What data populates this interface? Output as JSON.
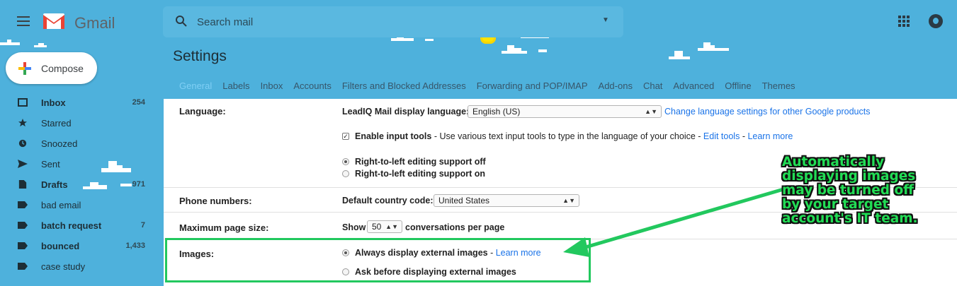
{
  "header": {
    "app_name": "Gmail",
    "search_placeholder": "Search mail"
  },
  "sidebar": {
    "compose_label": "Compose",
    "items": [
      {
        "label": "Inbox",
        "count": "254",
        "bold": true,
        "icon": "inbox-icon"
      },
      {
        "label": "Starred",
        "count": "",
        "bold": false,
        "icon": "star-icon"
      },
      {
        "label": "Snoozed",
        "count": "",
        "bold": false,
        "icon": "clock-icon"
      },
      {
        "label": "Sent",
        "count": "",
        "bold": false,
        "icon": "send-icon"
      },
      {
        "label": "Drafts",
        "count": "971",
        "bold": true,
        "icon": "draft-icon"
      },
      {
        "label": "bad email",
        "count": "",
        "bold": false,
        "icon": "label-icon"
      },
      {
        "label": "batch request",
        "count": "7",
        "bold": true,
        "icon": "label-icon"
      },
      {
        "label": "bounced",
        "count": "1,433",
        "bold": true,
        "icon": "label-icon"
      },
      {
        "label": "case study",
        "count": "",
        "bold": false,
        "icon": "label-icon"
      }
    ]
  },
  "settings": {
    "title": "Settings",
    "tabs": [
      "General",
      "Labels",
      "Inbox",
      "Accounts",
      "Filters and Blocked Addresses",
      "Forwarding and POP/IMAP",
      "Add-ons",
      "Chat",
      "Advanced",
      "Offline",
      "Themes"
    ],
    "active_tab": "General",
    "language": {
      "label": "Language:",
      "display_language_label": "LeadIQ Mail display language:",
      "display_language_value": "English (US)",
      "change_link": "Change language settings for other Google products",
      "input_tools_label": "Enable input tools",
      "input_tools_desc": "- Use various text input tools to type in the language of your choice -",
      "edit_tools_link": "Edit tools",
      "learn_more_link": "Learn more",
      "rtl_off": "Right-to-left editing support off",
      "rtl_on": "Right-to-left editing support on"
    },
    "phone": {
      "label": "Phone numbers:",
      "country_label": "Default country code:",
      "country_value": "United States"
    },
    "page_size": {
      "label": "Maximum page size:",
      "show_label": "Show",
      "value": "50",
      "suffix": "conversations per page"
    },
    "images": {
      "label": "Images:",
      "always_display": "Always display external images",
      "learn_more_link": "Learn more",
      "ask_before": "Ask before displaying external images"
    }
  },
  "annotation": {
    "text": "Automatically displaying images may be turned off by your target account's IT team.",
    "color": "#22dd55"
  },
  "colors": {
    "sky": "#4eb1dc",
    "link": "#1a73e8",
    "highlight": "#22c85e"
  }
}
